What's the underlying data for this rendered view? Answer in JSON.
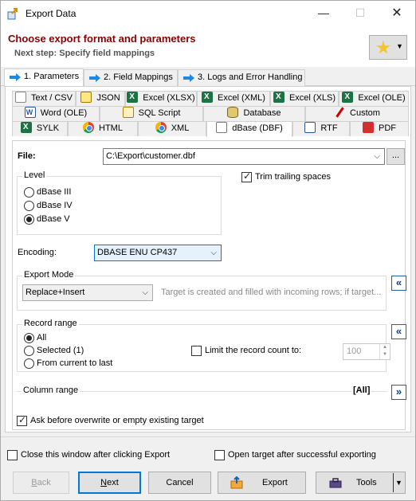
{
  "window": {
    "title": "Export Data",
    "minimize": "—",
    "maximize": "☐",
    "close": "✕"
  },
  "header": {
    "title": "Choose export format and parameters",
    "subtitle": "Next step: Specify field mappings"
  },
  "main_tabs": [
    "1. Parameters",
    "2. Field Mappings",
    "3. Logs and Error Handling"
  ],
  "format_tabs": {
    "row1": [
      "Text / CSV",
      "JSON",
      "Excel (XLSX)",
      "Excel (XML)",
      "Excel (XLS)",
      "Excel (OLE)"
    ],
    "row2": [
      "Word (OLE)",
      "SQL Script",
      "Database",
      "Custom"
    ],
    "row3": [
      "SYLK",
      "HTML",
      "XML",
      "dBase (DBF)",
      "RTF",
      "PDF"
    ],
    "active": "dBase (DBF)"
  },
  "file": {
    "label": "File:",
    "value": "C:\\Export\\customer.dbf",
    "browse": "..."
  },
  "level": {
    "title": "Level",
    "options": [
      "dBase III",
      "dBase IV",
      "dBase V"
    ],
    "selected": "dBase V"
  },
  "trim": {
    "label": "Trim trailing spaces",
    "checked": true
  },
  "encoding": {
    "label": "Encoding:",
    "value": "DBASE ENU CP437"
  },
  "export_mode": {
    "title": "Export Mode",
    "value": "Replace+Insert",
    "hint": "Target is created and filled with incoming rows; if target...",
    "toggle": "«"
  },
  "record_range": {
    "title": "Record range",
    "options": [
      "All",
      "Selected (1)",
      "From current to last"
    ],
    "selected": "All",
    "limit_label": "Limit the record count to:",
    "limit_checked": false,
    "limit_value": "100",
    "toggle": "«"
  },
  "column_range": {
    "title": "Column range",
    "value": "[All]",
    "toggle": "»"
  },
  "ask_overwrite": {
    "label": "Ask before overwrite or empty existing target",
    "checked": true
  },
  "footer": {
    "close_after": "Close this window after clicking Export",
    "open_target": "Open target after successful exporting",
    "back": "Back",
    "next": "Next",
    "cancel": "Cancel",
    "export": "Export",
    "tools": "Tools"
  }
}
